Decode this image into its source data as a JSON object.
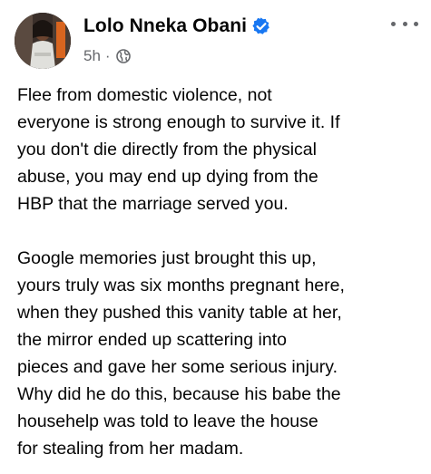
{
  "post": {
    "author": "Lolo Nneka Obani",
    "verified": true,
    "timestamp": "5h",
    "separator": "·",
    "audience_icon": "globe-icon",
    "menu_icon": "more-options-icon",
    "paragraphs": [
      [
        "Flee from domestic violence, not",
        "everyone is strong enough to survive it. If",
        "you don't die directly from the physical",
        "abuse, you may end up dying from the",
        "HBP that the marriage served you."
      ],
      [
        "Google memories just brought this up,",
        "yours truly was six months pregnant here,",
        "when they pushed this vanity table at her,",
        "the mirror ended up scattering into",
        "pieces and gave her some serious injury.",
        "Why did he do this, because his babe the",
        "househelp was told to leave the house",
        "for stealing from her madam."
      ]
    ]
  },
  "colors": {
    "text": "#050505",
    "secondary_text": "#65676b",
    "verified_badge": "#1877f2",
    "background": "#ffffff"
  }
}
